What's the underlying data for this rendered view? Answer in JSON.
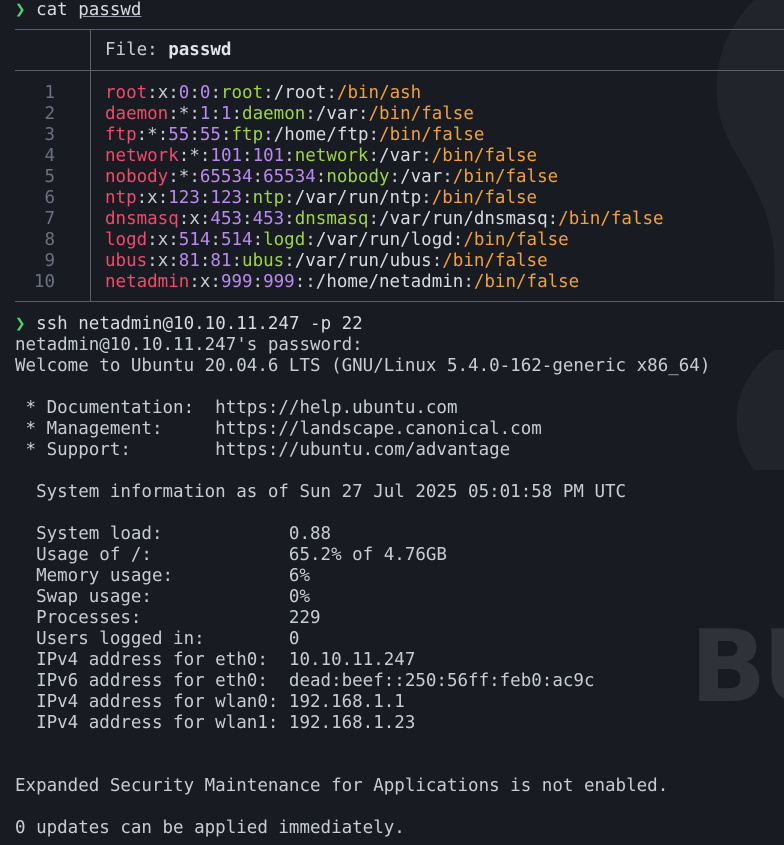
{
  "prompt1": {
    "arrow": "❯",
    "command": "cat",
    "argument": "passwd"
  },
  "file_header": {
    "label": "File:",
    "name": "passwd"
  },
  "passwd_lines": [
    {
      "num": "1",
      "user": "root",
      "pw": "x",
      "uid": "0",
      "gid": "0",
      "gecos": "root",
      "home": "/root",
      "shell": "/bin/ash"
    },
    {
      "num": "2",
      "user": "daemon",
      "pw": "*",
      "uid": "1",
      "gid": "1",
      "gecos": "daemon",
      "home": "/var",
      "shell": "/bin/false"
    },
    {
      "num": "3",
      "user": "ftp",
      "pw": "*",
      "uid": "55",
      "gid": "55",
      "gecos": "ftp",
      "home": "/home/ftp",
      "shell": "/bin/false"
    },
    {
      "num": "4",
      "user": "network",
      "pw": "*",
      "uid": "101",
      "gid": "101",
      "gecos": "network",
      "home": "/var",
      "shell": "/bin/false"
    },
    {
      "num": "5",
      "user": "nobody",
      "pw": "*",
      "uid": "65534",
      "gid": "65534",
      "gecos": "nobody",
      "home": "/var",
      "shell": "/bin/false"
    },
    {
      "num": "6",
      "user": "ntp",
      "pw": "x",
      "uid": "123",
      "gid": "123",
      "gecos": "ntp",
      "home": "/var/run/ntp",
      "shell": "/bin/false"
    },
    {
      "num": "7",
      "user": "dnsmasq",
      "pw": "x",
      "uid": "453",
      "gid": "453",
      "gecos": "dnsmasq",
      "home": "/var/run/dnsmasq",
      "shell": "/bin/false"
    },
    {
      "num": "8",
      "user": "logd",
      "pw": "x",
      "uid": "514",
      "gid": "514",
      "gecos": "logd",
      "home": "/var/run/logd",
      "shell": "/bin/false"
    },
    {
      "num": "9",
      "user": "ubus",
      "pw": "x",
      "uid": "81",
      "gid": "81",
      "gecos": "ubus",
      "home": "/var/run/ubus",
      "shell": "/bin/false"
    },
    {
      "num": "10",
      "user": "netadmin",
      "pw": "x",
      "uid": "999",
      "gid": "999",
      "gecos": "",
      "home": "/home/netadmin",
      "shell": "/bin/false"
    }
  ],
  "prompt2": {
    "arrow": "❯",
    "command": "ssh",
    "args": "netadmin@10.10.11.247 -p 22"
  },
  "output": {
    "password_prompt": "netadmin@10.10.11.247's password:",
    "welcome": "Welcome to Ubuntu 20.04.6 LTS (GNU/Linux 5.4.0-162-generic x86_64)",
    "doc_line": " * Documentation:  https://help.ubuntu.com",
    "mgmt_line": " * Management:     https://landscape.canonical.com",
    "support_line": " * Support:        https://ubuntu.com/advantage",
    "sysinfo": "  System information as of Sun 27 Jul 2025 05:01:58 PM UTC",
    "stats": [
      "  System load:            0.88",
      "  Usage of /:             65.2% of 4.76GB",
      "  Memory usage:           6%",
      "  Swap usage:             0%",
      "  Processes:              229",
      "  Users logged in:        0",
      "  IPv4 address for eth0:  10.10.11.247",
      "  IPv6 address for eth0:  dead:beef::250:56ff:feb0:ac9c",
      "  IPv4 address for wlan0: 192.168.1.1",
      "  IPv4 address for wlan1: 192.168.1.23"
    ],
    "esm": "Expanded Security Maintenance for Applications is not enabled.",
    "updates": "0 updates can be applied immediately."
  },
  "background": {
    "watermark_text": "BU",
    "logo_icon": "hackthebox-style-logo-icon"
  },
  "colors": {
    "background": "#191b22",
    "prompt_arrow": "#4fd36b",
    "user": "#f14a6a",
    "number": "#b98af0",
    "gecos": "#9fd449",
    "shell": "#f0a140"
  }
}
